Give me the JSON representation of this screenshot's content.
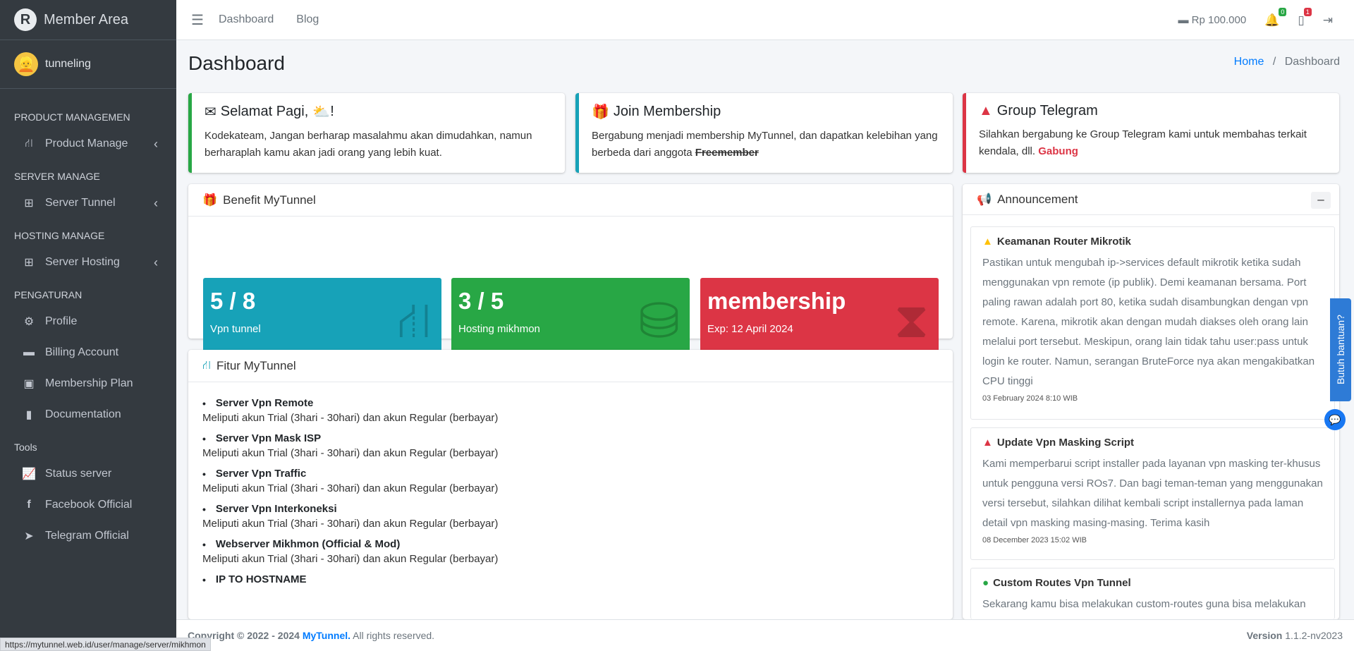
{
  "brand": {
    "title": "Member Area",
    "logo_letter": "R"
  },
  "user": {
    "name": "tunneling"
  },
  "nav": {
    "sections": [
      {
        "header": "PRODUCT MANAGEMEN",
        "items": [
          {
            "label": "Product Manage",
            "icon": "sitemap-icon",
            "expandable": true
          }
        ]
      },
      {
        "header": "SERVER MANAGE",
        "items": [
          {
            "label": "Server Tunnel",
            "icon": "network-icon",
            "expandable": true
          }
        ]
      },
      {
        "header": "HOSTING MANAGE",
        "items": [
          {
            "label": "Server Hosting",
            "icon": "network-icon",
            "expandable": true
          }
        ]
      },
      {
        "header": "PENGATURAN",
        "items": [
          {
            "label": "Profile",
            "icon": "gears-icon"
          },
          {
            "label": "Billing Account",
            "icon": "wallet-icon"
          },
          {
            "label": "Membership Plan",
            "icon": "id-card-icon"
          },
          {
            "label": "Documentation",
            "icon": "file-icon"
          }
        ]
      },
      {
        "header": "Tools",
        "items": [
          {
            "label": "Status server",
            "icon": "chart-line-icon"
          },
          {
            "label": "Facebook Official",
            "icon": "facebook-icon"
          },
          {
            "label": "Telegram Official",
            "icon": "telegram-icon"
          }
        ]
      }
    ]
  },
  "topbar": {
    "links": [
      "Dashboard",
      "Blog"
    ],
    "balance": "Rp 100.000",
    "notif_count": "0",
    "device_count": "1"
  },
  "page": {
    "title": "Dashboard",
    "breadcrumb_home": "Home",
    "breadcrumb_sep": "/",
    "breadcrumb_current": "Dashboard"
  },
  "callouts": {
    "greeting": {
      "title": "Selamat Pagi,",
      "suffix": "!",
      "text": "Kodekateam, Jangan berharap masalahmu akan dimudahkan, namun berharaplah kamu akan jadi orang yang lebih kuat."
    },
    "membership": {
      "title": "Join Membership",
      "text": "Bergabung menjadi membership MyTunnel, dan dapatkan kelebihan yang berbeda dari anggota",
      "strike": "Freemember"
    },
    "telegram": {
      "title": "Group Telegram",
      "text": "Silahkan bergabung ke Group Telegram kami untuk membahas terkait kendala, dll.",
      "link": "Gabung"
    }
  },
  "benefit": {
    "title": "Benefit MyTunnel",
    "boxes": [
      {
        "value": "5 / 8",
        "label": "Vpn tunnel",
        "color": "#17a2b8"
      },
      {
        "value": "3 / 5",
        "label": "Hosting mikhmon",
        "color": "#28a745"
      },
      {
        "value": "membership",
        "label": "Exp: 12 April 2024",
        "color": "#dc3545"
      }
    ]
  },
  "fitur": {
    "title": "Fitur MyTunnel",
    "items": [
      {
        "title": "Server Vpn Remote",
        "desc": "Meliputi akun Trial (3hari - 30hari) dan akun Regular (berbayar)"
      },
      {
        "title": "Server Vpn Mask ISP",
        "desc": "Meliputi akun Trial (3hari - 30hari) dan akun Regular (berbayar)"
      },
      {
        "title": "Server Vpn Traffic",
        "desc": "Meliputi akun Trial (3hari - 30hari) dan akun Regular (berbayar)"
      },
      {
        "title": "Server Vpn Interkoneksi",
        "desc": "Meliputi akun Trial (3hari - 30hari) dan akun Regular (berbayar)"
      },
      {
        "title": "Webserver Mikhmon (Official & Mod)",
        "desc": "Meliputi akun Trial (3hari - 30hari) dan akun Regular (berbayar)"
      },
      {
        "title": "IP TO HOSTNAME",
        "desc": ""
      }
    ]
  },
  "announcement": {
    "title": "Announcement",
    "collapse": "–",
    "items": [
      {
        "title": "Keamanan Router Mikrotik",
        "icon": "warning-icon",
        "color": "#ffc107",
        "body": "Pastikan untuk mengubah ip->services default mikrotik ketika sudah menggunakan vpn remote (ip publik). Demi keamanan bersama. Port paling rawan adalah port 80, ketika sudah disambungkan dengan vpn remote. Karena, mikrotik akan dengan mudah diakses oleh orang lain melalui port tersebut. Meskipun, orang lain tidak tahu user:pass untuk login ke router. Namun, serangan BruteForce nya akan mengakibatkan CPU tinggi",
        "date": "03 February 2024 8:10 WIB"
      },
      {
        "title": "Update Vpn Masking Script",
        "icon": "warning-icon",
        "color": "#dc3545",
        "body": "Kami memperbarui script installer pada layanan vpn masking ter-khusus untuk pengguna versi ROs7. Dan bagi teman-teman yang menggunakan versi tersebut, silahkan dilihat kembali script installernya pada laman detail vpn masking masing-masing. Terima kasih",
        "date": "08 December 2023 15:02 WIB"
      },
      {
        "title": "Custom Routes Vpn Tunnel",
        "icon": "info-icon",
        "color": "#28a745",
        "body": "Sekarang kamu bisa melakukan custom-routes guna bisa melakukan",
        "date": ""
      }
    ]
  },
  "footer": {
    "copyright": "Copyright © 2022 - 2024",
    "brand": "MyTunnel.",
    "rights": "All rights reserved.",
    "version_label": "Version",
    "version": "1.1.2-nv2023"
  },
  "statusbar": {
    "url": "https://mytunnel.web.id/user/manage/server/mikhmon"
  },
  "help": {
    "label": "Butuh bantuan?"
  }
}
